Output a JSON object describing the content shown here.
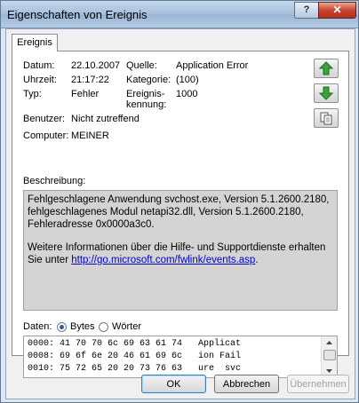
{
  "window": {
    "title": "Eigenschaften von Ereignis",
    "help": "?",
    "close": "✕"
  },
  "tab": {
    "label": "Ereignis"
  },
  "fields": {
    "datum_label": "Datum:",
    "datum_value": "22.10.2007",
    "uhrzeit_label": "Uhrzeit:",
    "uhrzeit_value": "21:17:22",
    "typ_label": "Typ:",
    "typ_value": "Fehler",
    "benutzer_label": "Benutzer:",
    "benutzer_value": "Nicht zutreffend",
    "computer_label": "Computer:",
    "computer_value": "MEINER",
    "quelle_label": "Quelle:",
    "quelle_value": "Application Error",
    "kategorie_label": "Kategorie:",
    "kategorie_value": "(100)",
    "kennung_label_1": "Ereignis-",
    "kennung_label_2": "kennung:",
    "kennung_value": "1000"
  },
  "nav_buttons": {
    "up_icon": "arrow-up-icon",
    "down_icon": "arrow-down-icon",
    "copy_icon": "copy-icon"
  },
  "description": {
    "label": "Beschreibung:",
    "line1": "Fehlgeschlagene Anwendung svchost.exe, Version 5.1.2600.2180, fehlgeschlagenes Modul netapi32.dll, Version 5.1.2600.2180, Fehleradresse 0x0000a3c0.",
    "line2_prefix": "Weitere Informationen über die Hilfe- und Supportdienste erhalten Sie unter ",
    "link": "http://go.microsoft.com/fwlink/events.asp",
    "line2_suffix": "."
  },
  "data_section": {
    "label": "Daten:",
    "bytes": "Bytes",
    "words": "Wörter",
    "selected": "bytes"
  },
  "hex_lines": [
    "0000: 41 70 70 6c 69 63 61 74   Applicat",
    "0008: 69 6f 6e 20 46 61 69 6c   ion Fail",
    "0010: 75 72 65 20 20 73 76 63   ure  svc"
  ],
  "buttons": {
    "ok": "OK",
    "cancel": "Abbrechen",
    "apply": "Übernehmen"
  }
}
